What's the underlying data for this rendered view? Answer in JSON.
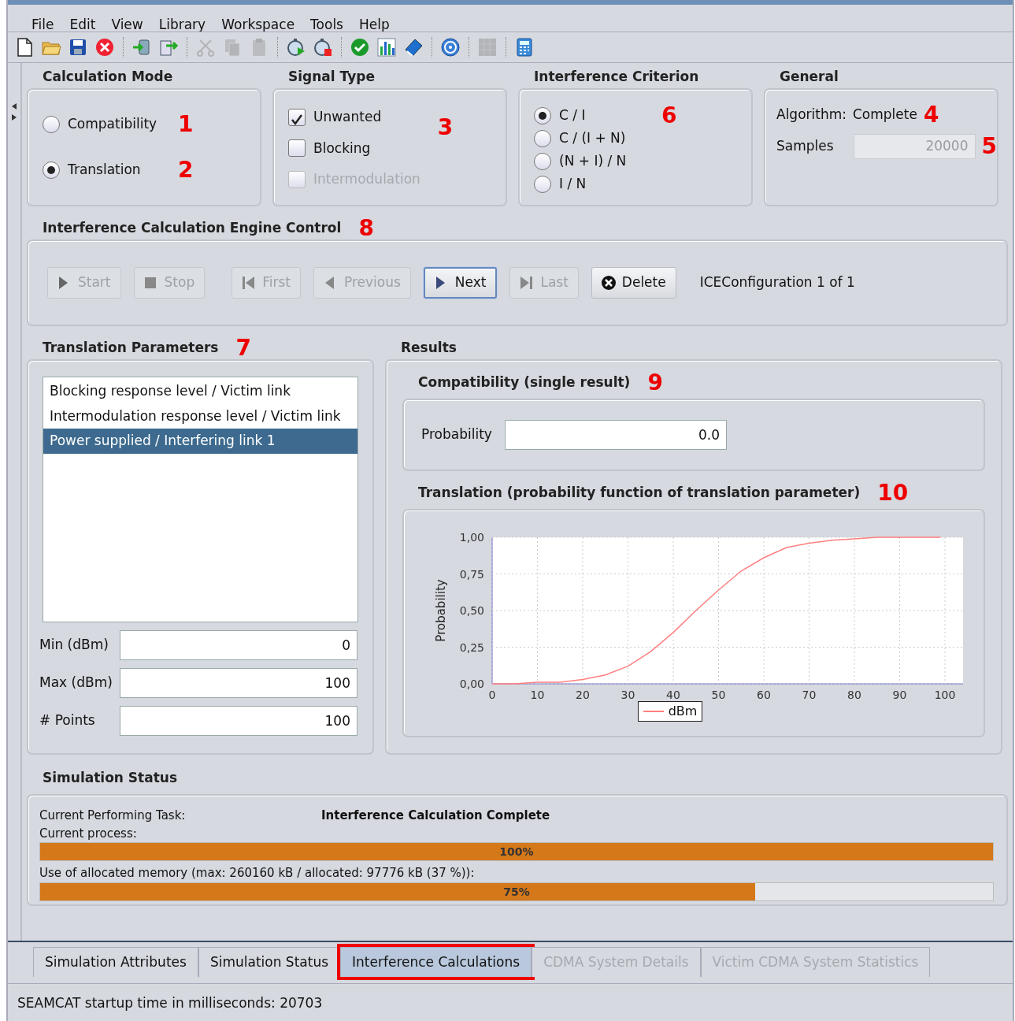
{
  "menu": [
    "File",
    "Edit",
    "View",
    "Library",
    "Workspace",
    "Tools",
    "Help"
  ],
  "toolbar": [
    [
      {
        "kind": "new",
        "disabled": false
      },
      {
        "kind": "open",
        "disabled": false
      },
      {
        "kind": "save",
        "disabled": false
      },
      {
        "kind": "close",
        "disabled": false
      }
    ],
    [
      {
        "kind": "import",
        "disabled": false
      },
      {
        "kind": "export",
        "disabled": false
      }
    ],
    [
      {
        "kind": "cut",
        "disabled": true
      },
      {
        "kind": "copy",
        "disabled": true
      },
      {
        "kind": "paste",
        "disabled": true
      }
    ],
    [
      {
        "kind": "run",
        "disabled": false
      },
      {
        "kind": "stoprun",
        "disabled": false
      }
    ],
    [
      {
        "kind": "check",
        "disabled": false
      },
      {
        "kind": "chart",
        "disabled": false
      },
      {
        "kind": "book",
        "disabled": false
      }
    ],
    [
      {
        "kind": "help",
        "disabled": false
      }
    ],
    [
      {
        "kind": "grid",
        "disabled": true
      }
    ],
    [
      {
        "kind": "calc",
        "disabled": false
      }
    ]
  ],
  "calculation_mode": {
    "title": "Calculation Mode",
    "options": [
      {
        "label": "Compatibility",
        "selected": false,
        "marker": "1"
      },
      {
        "label": "Translation",
        "selected": true,
        "marker": "2"
      }
    ]
  },
  "signal_type": {
    "title": "Signal Type",
    "marker": "3",
    "options": [
      {
        "label": "Unwanted",
        "checked": true,
        "disabled": false
      },
      {
        "label": "Blocking",
        "checked": false,
        "disabled": false
      },
      {
        "label": "Intermodulation",
        "checked": false,
        "disabled": true
      }
    ]
  },
  "interference_criterion": {
    "title": "Interference Criterion",
    "options": [
      {
        "label": "C / I",
        "selected": true,
        "marker": "6"
      },
      {
        "label": "C / (I + N)",
        "selected": false
      },
      {
        "label": "(N + I) / N",
        "selected": false
      },
      {
        "label": "I / N",
        "selected": false
      }
    ]
  },
  "general": {
    "title": "General",
    "algorithm_label": "Algorithm:",
    "algorithm": "Complete",
    "algorithm_marker": "4",
    "samples_label": "Samples",
    "samples": "20000",
    "samples_marker": "5"
  },
  "engine_control": {
    "title": "Interference Calculation Engine Control",
    "marker": "8",
    "buttons": [
      {
        "label": "Start",
        "kind": "play",
        "disabled": true,
        "focused": false
      },
      {
        "label": "Stop",
        "kind": "stop",
        "disabled": true,
        "focused": false
      },
      {
        "label": "First",
        "kind": "first",
        "disabled": true,
        "focused": false
      },
      {
        "label": "Previous",
        "kind": "prev",
        "disabled": true,
        "focused": false
      },
      {
        "label": "Next",
        "kind": "play",
        "disabled": false,
        "focused": true
      },
      {
        "label": "Last",
        "kind": "last",
        "disabled": true,
        "focused": false
      },
      {
        "label": "Delete",
        "kind": "delete",
        "disabled": false,
        "focused": false
      }
    ],
    "status": "ICEConfiguration 1 of 1"
  },
  "translation_parameters": {
    "title": "Translation Parameters",
    "marker": "7",
    "items": [
      {
        "label": "Blocking response level / Victim link",
        "selected": false
      },
      {
        "label": "Intermodulation response level / Victim link",
        "selected": false
      },
      {
        "label": "Power supplied / Interfering link 1",
        "selected": true
      }
    ],
    "fields": [
      {
        "label": "Min (dBm)",
        "value": "0"
      },
      {
        "label": "Max (dBm)",
        "value": "100"
      },
      {
        "label": "# Points",
        "value": "100"
      }
    ]
  },
  "results": {
    "title": "Results",
    "compatibility": {
      "title": "Compatibility (single result)",
      "marker": "9",
      "label": "Probability",
      "value": "0.0"
    },
    "translation": {
      "title": "Translation (probability function of translation parameter)",
      "marker": "10",
      "chart_data": {
        "type": "line",
        "ylabel": "Probability",
        "x": [
          0,
          5,
          10,
          15,
          20,
          25,
          30,
          35,
          40,
          45,
          50,
          55,
          60,
          65,
          70,
          75,
          80,
          85,
          90,
          95,
          99
        ],
        "series": [
          {
            "name": "dBm",
            "color": "#ff7f7f",
            "values": [
              0,
              0,
              0.01,
              0.01,
              0.03,
              0.06,
              0.12,
              0.22,
              0.35,
              0.5,
              0.64,
              0.77,
              0.86,
              0.93,
              0.96,
              0.98,
              0.99,
              1,
              1,
              1,
              1
            ]
          }
        ],
        "grid": true,
        "xlim": [
          0,
          104
        ],
        "ylim": [
          0,
          1
        ],
        "xticks": [
          0,
          10,
          20,
          30,
          40,
          50,
          60,
          70,
          80,
          90,
          100
        ],
        "yticks": [
          {
            "value": 0,
            "label": "0,00"
          },
          {
            "value": 0.25,
            "label": "0,25"
          },
          {
            "value": 0.5,
            "label": "0,50"
          },
          {
            "value": 0.75,
            "label": "0,75"
          },
          {
            "value": 1,
            "label": "1,00"
          }
        ]
      }
    }
  },
  "simulation_status": {
    "title": "Simulation Status",
    "task_label": "Current Performing Task:",
    "task": "Interference Calculation Complete",
    "process_label": "Current process:",
    "process_bar": {
      "level": 1,
      "text": "100%"
    },
    "memory_label": "Use of allocated memory (max: 260160 kB / allocated: 97776 kB (37 %)):",
    "memory_bar": {
      "level": 0.75,
      "text": "75%"
    }
  },
  "tabs": [
    {
      "label": "Simulation Attributes",
      "selected": false,
      "disabled": false,
      "highlighted": false
    },
    {
      "label": "Simulation Status",
      "selected": false,
      "disabled": false,
      "highlighted": false
    },
    {
      "label": "Interference Calculations",
      "selected": true,
      "disabled": false,
      "highlighted": true
    },
    {
      "label": "CDMA System Details",
      "selected": false,
      "disabled": true,
      "highlighted": false
    },
    {
      "label": "Victim CDMA System Statistics",
      "selected": false,
      "disabled": true,
      "highlighted": false
    }
  ],
  "status_bar": "SEAMCAT startup time in milliseconds: 20703"
}
